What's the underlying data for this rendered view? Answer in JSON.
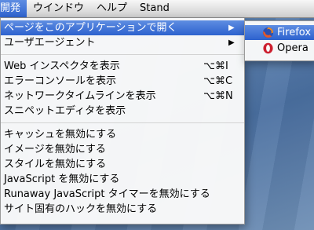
{
  "menubar": {
    "items": [
      {
        "label": "開発"
      },
      {
        "label": "ウインドウ"
      },
      {
        "label": "ヘルプ"
      },
      {
        "label": "Stand"
      }
    ]
  },
  "menu": {
    "open_with": "ページをこのアプリケーションで開く",
    "user_agent": "ユーザエージェント",
    "web_inspector": "Web インスペクタを表示",
    "web_inspector_sc": "⌥⌘I",
    "error_console": "エラーコンソールを表示",
    "error_console_sc": "⌥⌘C",
    "network_timeline": "ネットワークタイムラインを表示",
    "network_timeline_sc": "⌥⌘N",
    "snippet_editor": "スニペットエディタを表示",
    "disable_cache": "キャッシュを無効にする",
    "disable_images": "イメージを無効にする",
    "disable_styles": "スタイルを無効にする",
    "disable_javascript": "JavaScript を無効にする",
    "disable_runaway": "Runaway JavaScript タイマーを無効にする",
    "disable_site_hacks": "サイト固有のハックを無効にする"
  },
  "submenu": {
    "items": [
      {
        "label": "Firefox",
        "icon": "firefox-icon"
      },
      {
        "label": "Opera",
        "icon": "opera-icon"
      }
    ]
  },
  "colors": {
    "highlight": "#3a6fd8",
    "desktop": "#5d82b0"
  }
}
